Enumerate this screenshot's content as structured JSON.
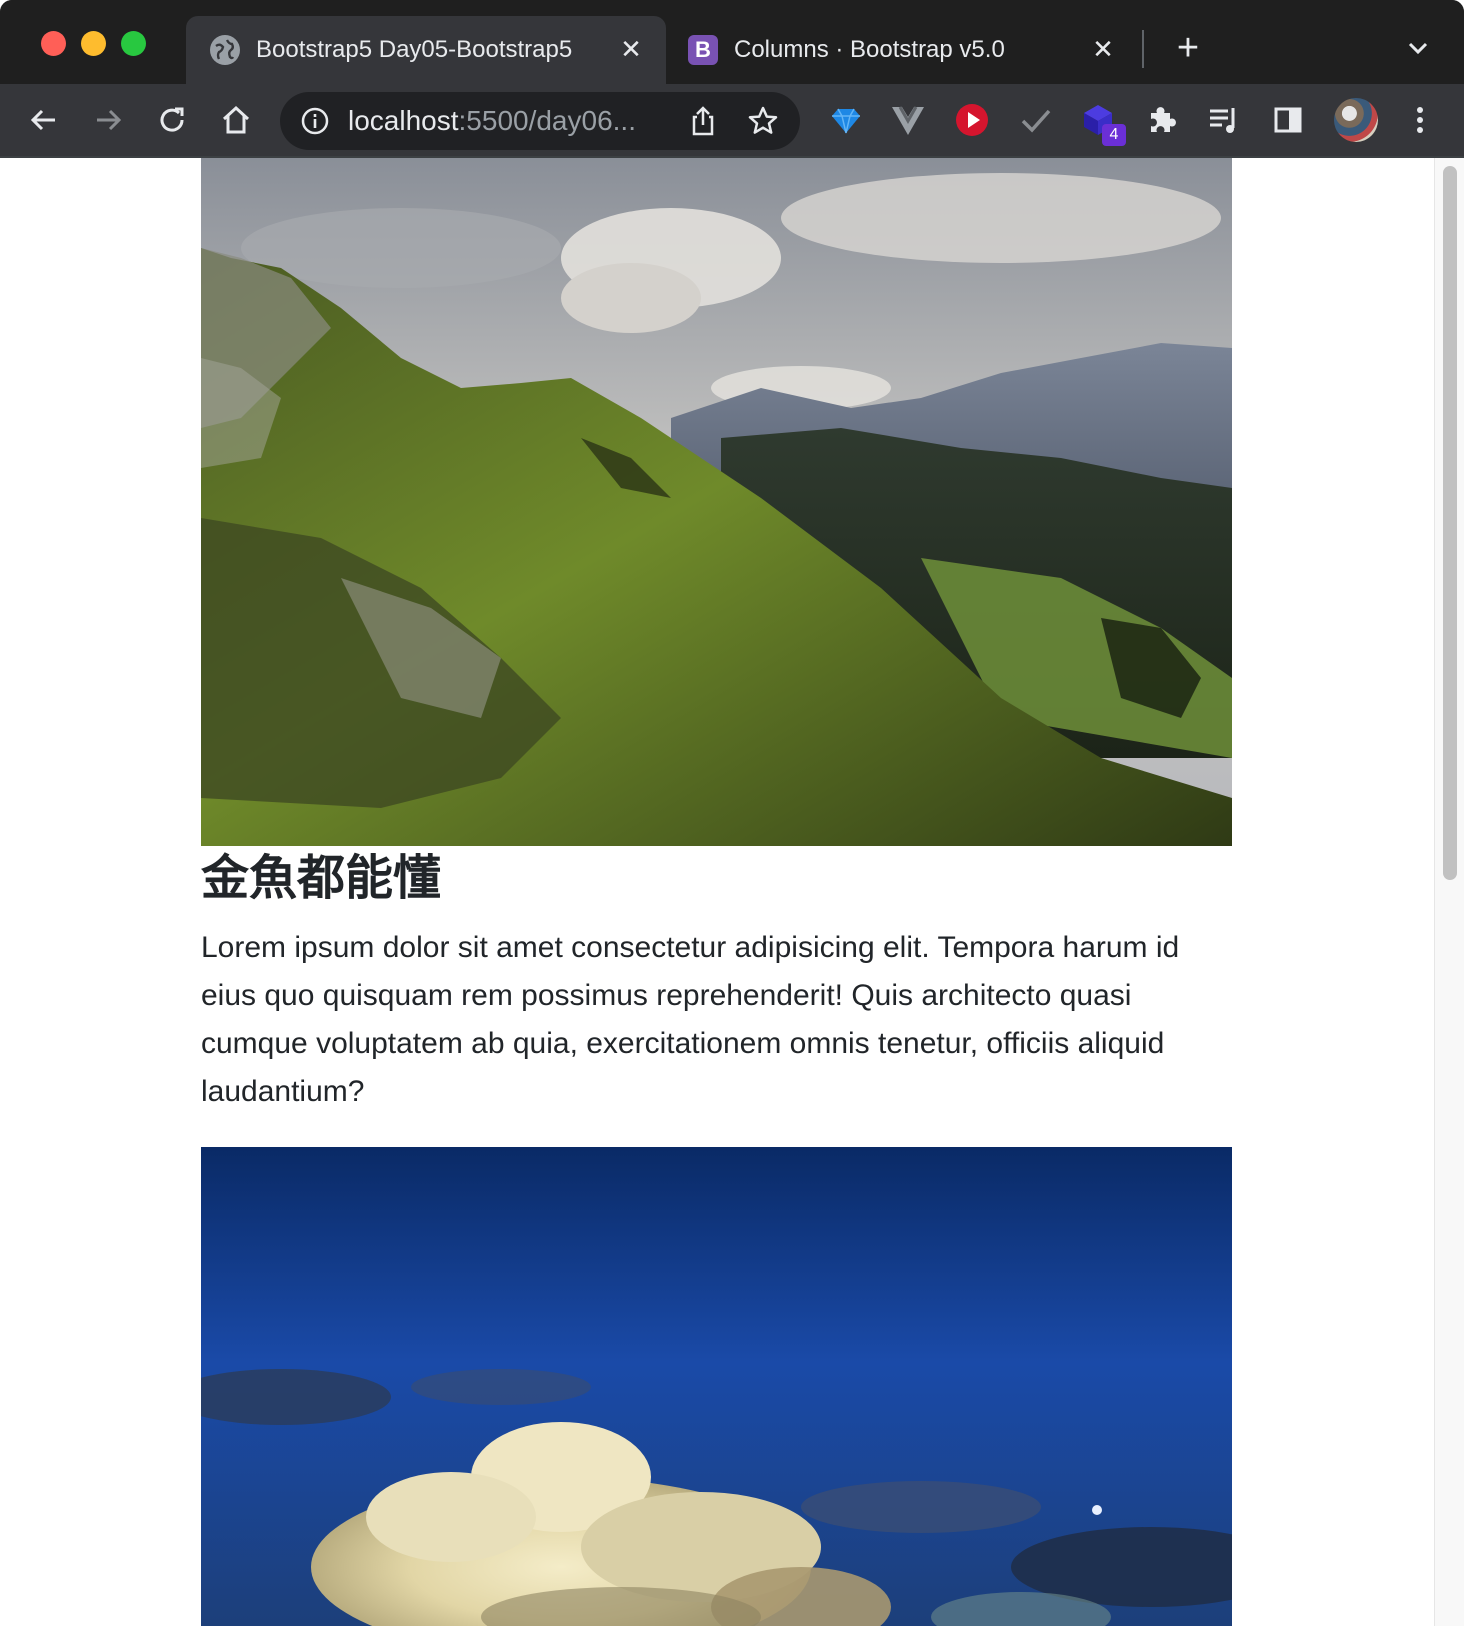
{
  "browser": {
    "tabs": [
      {
        "title": "Bootstrap5 Day05-Bootstrap5",
        "active": true,
        "favicon": "globe-icon"
      },
      {
        "title": "Columns · Bootstrap v5.0",
        "active": false,
        "favicon": "bootstrap-logo-icon",
        "favicon_text": "B"
      }
    ],
    "address": {
      "host": "localhost",
      "rest": ":5500/day06..."
    },
    "extensions": [
      {
        "name": "gem-extension-icon",
        "badge": ""
      },
      {
        "name": "vue-devtools-icon",
        "badge": ""
      },
      {
        "name": "red-play-extension-icon",
        "badge": ""
      },
      {
        "name": "checkmark-extension-icon",
        "badge": ""
      },
      {
        "name": "cube-extension-icon",
        "badge": "4"
      }
    ]
  },
  "page": {
    "heading": "金魚都能懂",
    "paragraph": "Lorem ipsum dolor sit amet consectetur adipisicing elit. Tempora harum id eius quo quisquam rem possimus reprehenderit! Quis architecto quasi cumque voluptatem ab quia, exercitationem omnis tenetur, officiis aliquid laudantium?",
    "images": [
      {
        "name": "mountain-landscape-image"
      },
      {
        "name": "cloudy-night-sky-image"
      }
    ]
  },
  "colors": {
    "chrome_dark": "#202124",
    "tab_active": "#35363a",
    "text": "#212529",
    "bootstrap_purple": "#7952b3"
  }
}
